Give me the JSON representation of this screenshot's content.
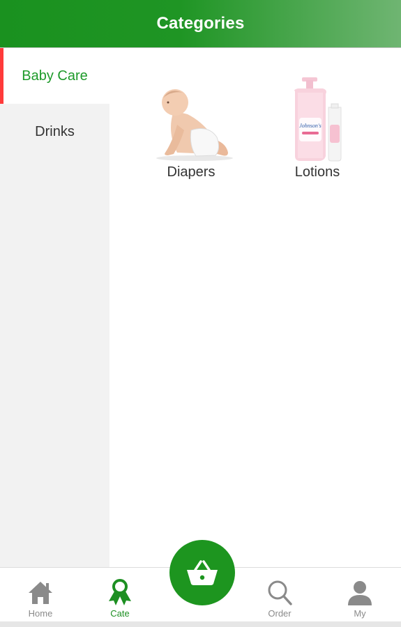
{
  "header": {
    "title": "Categories"
  },
  "sidebar": {
    "items": [
      {
        "label": "Baby Care",
        "active": true
      },
      {
        "label": "Drinks",
        "active": false
      }
    ]
  },
  "categories": [
    {
      "label": "Diapers",
      "image": "baby-photo"
    },
    {
      "label": "Lotions",
      "image": "lotion-bottle-photo",
      "brand_text": "Johnson's"
    }
  ],
  "tabbar": {
    "tabs": [
      {
        "label": "Home",
        "icon": "home-icon",
        "active": false
      },
      {
        "label": "Cate",
        "icon": "category-ribbon-icon",
        "active": true
      },
      {
        "label": "Order",
        "icon": "search-icon",
        "active": false
      },
      {
        "label": "My",
        "icon": "person-icon",
        "active": false
      }
    ],
    "cart_icon": "basket-icon"
  },
  "colors": {
    "primary_green": "#1d951f",
    "active_indicator": "#ff3a3a",
    "sidebar_bg": "#f2f2f2"
  }
}
